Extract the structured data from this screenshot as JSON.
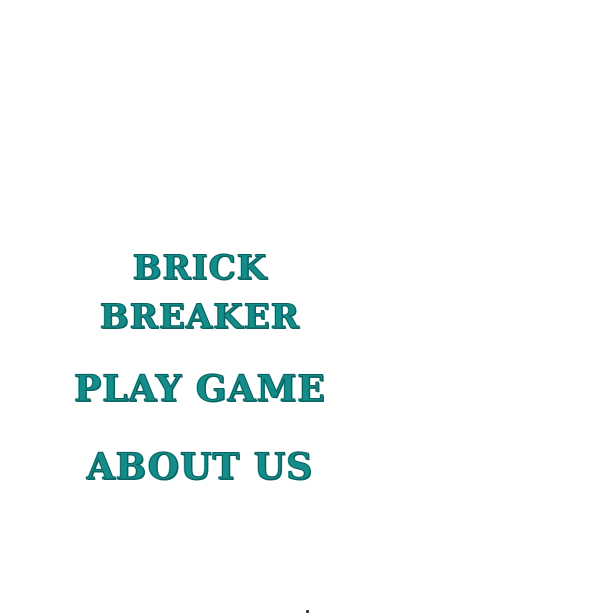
{
  "menu": {
    "title_line_1": "BRICK",
    "title_line_2": "BREAKER",
    "play_label": "PLAY GAME",
    "about_label": "ABOUT US"
  },
  "colors": {
    "text_primary": "#138c8a",
    "text_outline": "#0a5e5c",
    "background": "#ffffff"
  }
}
